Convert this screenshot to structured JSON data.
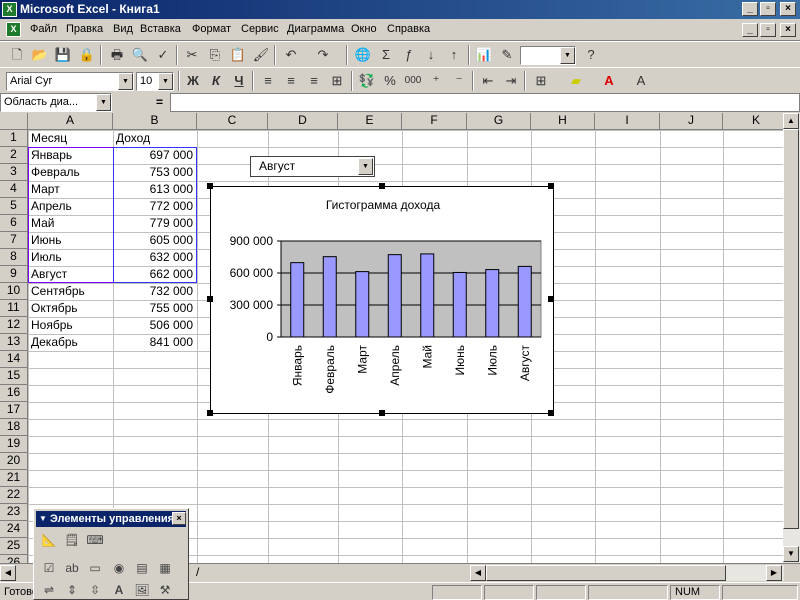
{
  "window": {
    "title": "Microsoft Excel - Книга1",
    "buttons": [
      "_",
      "▫",
      "×"
    ]
  },
  "menu": [
    "Файл",
    "Правка",
    "Вид",
    "Вставка",
    "Формат",
    "Сервис",
    "Диаграмма",
    "Окно",
    "Справка"
  ],
  "toolbar": {
    "font_name": "Arial Cyr",
    "font_size": "10",
    "bold": "Ж",
    "italic": "К",
    "underline": "Ч",
    "percent": "%",
    "thousands": "000",
    "zoom": ""
  },
  "formula_bar": {
    "name_box": "Область диа...",
    "equals": "="
  },
  "columns": [
    "A",
    "B",
    "C",
    "D",
    "E",
    "F",
    "G",
    "H",
    "I",
    "J",
    "K"
  ],
  "rows": [
    "1",
    "2",
    "3",
    "4",
    "5",
    "6",
    "7",
    "8",
    "9",
    "10",
    "11",
    "12",
    "13",
    "14",
    "15",
    "16",
    "17",
    "18",
    "19",
    "20",
    "21",
    "22",
    "23",
    "24",
    "25",
    "26"
  ],
  "sheet": {
    "header": {
      "a": "Месяц",
      "b": "Доход"
    },
    "data": [
      {
        "a": "Январь",
        "b": "697 000"
      },
      {
        "a": "Февраль",
        "b": "753 000"
      },
      {
        "a": "Март",
        "b": "613 000"
      },
      {
        "a": "Апрель",
        "b": "772 000"
      },
      {
        "a": "Май",
        "b": "779 000"
      },
      {
        "a": "Июнь",
        "b": "605 000"
      },
      {
        "a": "Июль",
        "b": "632 000"
      },
      {
        "a": "Август",
        "b": "662 000"
      },
      {
        "a": "Сентябрь",
        "b": "732 000"
      },
      {
        "a": "Октябрь",
        "b": "755 000"
      },
      {
        "a": "Ноябрь",
        "b": "506 000"
      },
      {
        "a": "Декабрь",
        "b": "841 000"
      }
    ]
  },
  "dropdown": {
    "value": "Август"
  },
  "chart_data": {
    "type": "bar",
    "title": "Гистограмма дохода",
    "categories": [
      "Январь",
      "Февраль",
      "Март",
      "Апрель",
      "Май",
      "Июнь",
      "Июль",
      "Август"
    ],
    "values": [
      697000,
      753000,
      613000,
      772000,
      779000,
      605000,
      632000,
      662000
    ],
    "yticks": [
      "0",
      "300 000",
      "600 000",
      "900 000"
    ],
    "ylim": [
      0,
      900000
    ],
    "bar_color": "#9999ff",
    "plot_bg": "#c0c0c0",
    "grid": true
  },
  "forms_toolbar": {
    "title": "Элементы управления"
  },
  "status": {
    "left": "Готово",
    "num": "NUM"
  }
}
